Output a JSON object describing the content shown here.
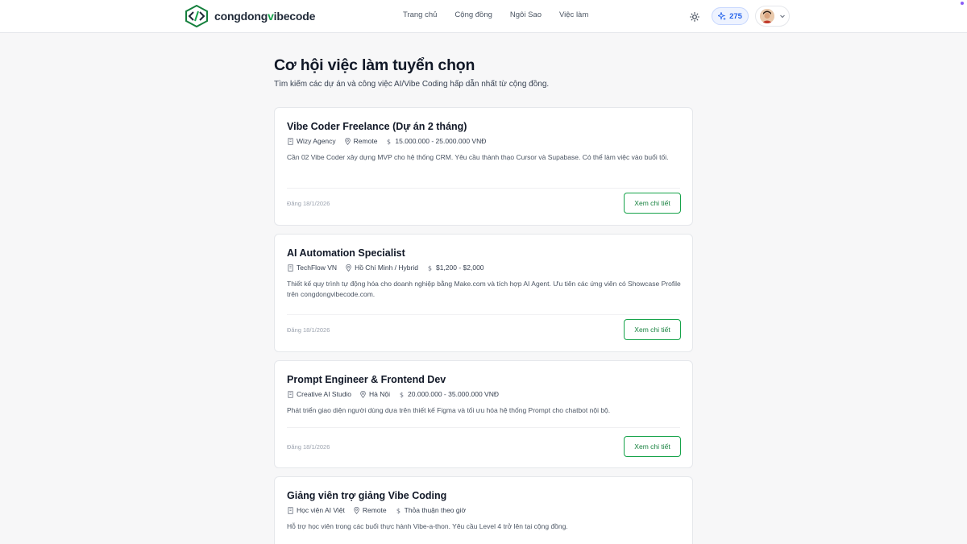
{
  "header": {
    "logo_a": "congdong",
    "logo_b": "v",
    "logo_c": "ibecode",
    "nav": [
      "Trang chủ",
      "Cộng đồng",
      "Ngôi Sao",
      "Việc làm"
    ],
    "points": "275",
    "icons": {
      "theme": "sun-icon",
      "points": "sparkle-icon",
      "user_menu": "chevron-down-icon"
    }
  },
  "main": {
    "title": "Cơ hội việc làm tuyển chọn",
    "subtitle": "Tìm kiếm các dự án và công việc AI/Vibe Coding hấp dẫn nhất từ cộng đồng.",
    "detail_label": "Xem chi tiết",
    "jobs": [
      {
        "title": "Vibe Coder Freelance (Dự án 2 tháng)",
        "company": "Wizy Agency",
        "location": "Remote",
        "salary": "15.000.000 - 25.000.000 VNĐ",
        "description": "Cần 02 Vibe Coder xây dựng MVP cho hệ thống CRM. Yêu cầu thành thạo Cursor và Supabase. Có thể làm việc vào buổi tối.",
        "posted": "Đăng 18/1/2026"
      },
      {
        "title": "AI Automation Specialist",
        "company": "TechFlow VN",
        "location": "Hồ Chí Minh / Hybrid",
        "salary": "$1,200 - $2,000",
        "description": "Thiết kế quy trình tự động hóa cho doanh nghiệp bằng Make.com và tích hợp AI Agent. Ưu tiên các ứng viên có Showcase Profile trên congdongvibecode.com.",
        "posted": "Đăng 18/1/2026"
      },
      {
        "title": "Prompt Engineer & Frontend Dev",
        "company": "Creative AI Studio",
        "location": "Hà Nội",
        "salary": "20.000.000 - 35.000.000 VNĐ",
        "description": "Phát triển giao diện người dùng dựa trên thiết kế Figma và tối ưu hóa hệ thống Prompt cho chatbot nội bộ.",
        "posted": "Đăng 18/1/2026"
      },
      {
        "title": "Giảng viên trợ giảng Vibe Coding",
        "company": "Học viện AI Việt",
        "location": "Remote",
        "salary": "Thỏa thuận theo giờ",
        "description": "Hỗ trợ học viên trong các buổi thực hành Vibe-a-thon. Yêu cầu Level 4 trở lên tại cộng đồng."
      }
    ]
  }
}
